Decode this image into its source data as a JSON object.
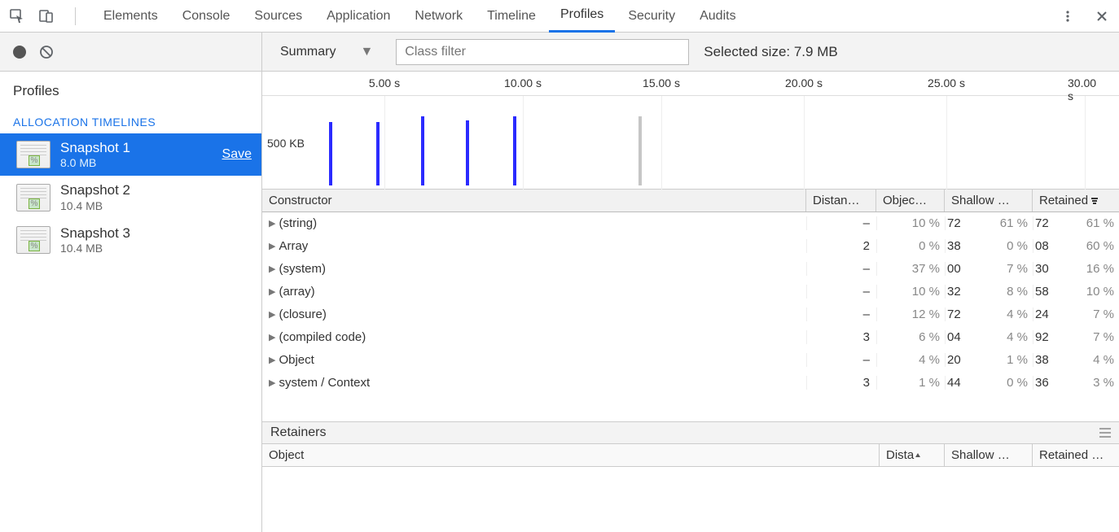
{
  "tabs": [
    "Elements",
    "Console",
    "Sources",
    "Application",
    "Network",
    "Timeline",
    "Profiles",
    "Security",
    "Audits"
  ],
  "activeTab": "Profiles",
  "sidebar": {
    "title": "Profiles",
    "section": "ALLOCATION TIMELINES",
    "saveLabel": "Save",
    "snapshots": [
      {
        "name": "Snapshot 1",
        "size": "8.0 MB",
        "selected": true
      },
      {
        "name": "Snapshot 2",
        "size": "10.4 MB",
        "selected": false
      },
      {
        "name": "Snapshot 3",
        "size": "10.4 MB",
        "selected": false
      }
    ]
  },
  "filterBar": {
    "dropdown": "Summary",
    "classFilterPlaceholder": "Class filter",
    "selectedSize": "Selected size: 7.9 MB"
  },
  "timeline": {
    "ticks": [
      "5.00 s",
      "10.00 s",
      "15.00 s",
      "20.00 s",
      "25.00 s",
      "30.00 s"
    ],
    "yLabel": "500 KB"
  },
  "constructorTable": {
    "headers": {
      "constructor": "Constructor",
      "distance": "Distan…",
      "objects": "Objec…",
      "shallow": "Shallow …",
      "retained": "Retained"
    },
    "rows": [
      {
        "name": "(string)",
        "dist": "–",
        "objPct": "10 %",
        "shSuffix": "72",
        "shPct": "61 %",
        "retSuffix": "72",
        "retPct": "61 %"
      },
      {
        "name": "Array",
        "dist": "2",
        "objPct": "0 %",
        "shSuffix": "38",
        "shPct": "0 %",
        "retSuffix": "08",
        "retPct": "60 %"
      },
      {
        "name": "(system)",
        "dist": "–",
        "objPct": "37 %",
        "shSuffix": "00",
        "shPct": "7 %",
        "retSuffix": "30",
        "retPct": "16 %"
      },
      {
        "name": "(array)",
        "dist": "–",
        "objPct": "10 %",
        "shSuffix": "32",
        "shPct": "8 %",
        "retSuffix": "58",
        "retPct": "10 %"
      },
      {
        "name": "(closure)",
        "dist": "–",
        "objPct": "12 %",
        "shSuffix": "72",
        "shPct": "4 %",
        "retSuffix": "24",
        "retPct": "7 %"
      },
      {
        "name": "(compiled code)",
        "dist": "3",
        "objPct": "6 %",
        "shSuffix": "04",
        "shPct": "4 %",
        "retSuffix": "92",
        "retPct": "7 %"
      },
      {
        "name": "Object",
        "dist": "–",
        "objPct": "4 %",
        "shSuffix": "20",
        "shPct": "1 %",
        "retSuffix": "38",
        "retPct": "4 %"
      },
      {
        "name": "system / Context",
        "dist": "3",
        "objPct": "1 %",
        "shSuffix": "44",
        "shPct": "0 %",
        "retSuffix": "36",
        "retPct": "3 %"
      }
    ]
  },
  "retainers": {
    "title": "Retainers",
    "headers": {
      "object": "Object",
      "distance": "Dista",
      "shallow": "Shallow …",
      "retained": "Retained …"
    }
  }
}
